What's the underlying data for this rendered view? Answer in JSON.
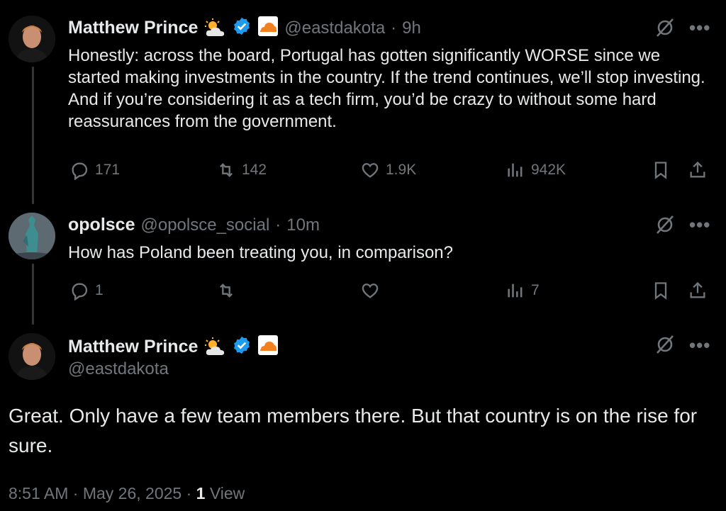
{
  "colors": {
    "bg": "#000000",
    "text": "#e7e9ea",
    "muted": "#71767b",
    "verified": "#1d9bf0",
    "cloudflare": "#f38020"
  },
  "tweet1": {
    "name": "Matthew Prince",
    "handle": "@eastdakota",
    "separator": "·",
    "time": "9h",
    "text": "Honestly: across the board, Portugal has gotten significantly WORSE since we started making investments in the country. If the trend continues, we’ll stop investing. And if you’re considering it as a tech firm, you’d be crazy to without some hard reassurances from the government.",
    "replies": "171",
    "reposts": "142",
    "likes": "1.9K",
    "views": "942K"
  },
  "tweet2": {
    "name": "opolsce",
    "handle": "@opolsce_social",
    "separator": "·",
    "time": "10m",
    "text": "How has Poland been treating you, in comparison?",
    "replies": "1",
    "views": "7"
  },
  "tweet3": {
    "name": "Matthew Prince",
    "handle": "@eastdakota",
    "text": "Great. Only have a few team members there. But that country is on the rise for sure.",
    "time": "8:51 AM",
    "sep1": "·",
    "date": "May 26, 2025",
    "sep2": "·",
    "views_count": "1",
    "views_label": "View"
  },
  "icons": [
    "grok-icon",
    "more-icon",
    "reply-icon",
    "repost-icon",
    "like-icon",
    "views-icon",
    "bookmark-icon",
    "share-icon",
    "verified-icon",
    "sun-cloud-emoji",
    "cloudflare-icon"
  ]
}
